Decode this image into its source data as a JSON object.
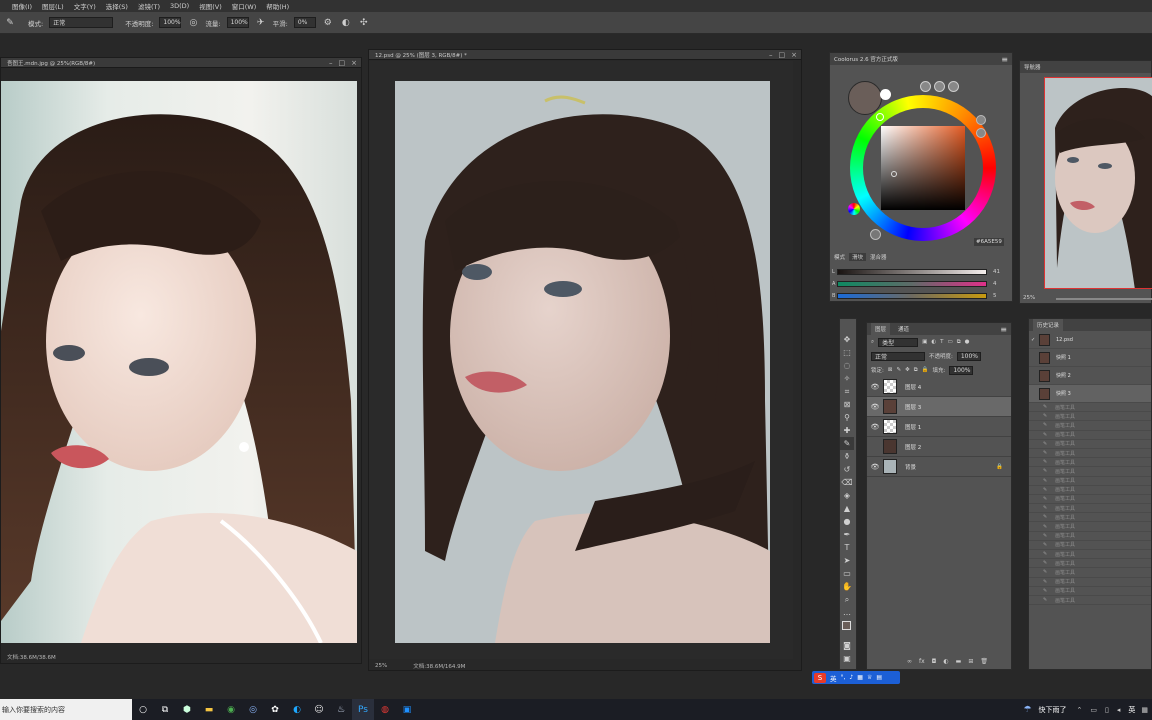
{
  "menu": [
    "图像(I)",
    "图层(L)",
    "文字(Y)",
    "选择(S)",
    "滤镜(T)",
    "3D(D)",
    "视图(V)",
    "窗口(W)",
    "帮助(H)"
  ],
  "options_bar": {
    "mode_label": "模式:",
    "mode_value": "正常",
    "opacity_label": "不透明度:",
    "opacity_value": "100%",
    "flow_label": "流量:",
    "flow_value": "100%",
    "smooth_label": "平滑:",
    "smooth_value": "0%"
  },
  "doc_left": {
    "title": "吾图王.mdn.jpg @ 25%(RGB/8#)",
    "status": "文档:38.6M/38.6M"
  },
  "doc_center": {
    "title": "12.psd @ 25% (图层 3, RGB/8#) *",
    "zoom": "25%",
    "status": "文档:38.6M/164.9M"
  },
  "coolorus": {
    "title": "Coolorus 2.6 官方正式版",
    "hex": "#6A5E59",
    "tab_mode": "模式",
    "tab_slider": "滑块",
    "tab_mixer": "混合器",
    "sliders": [
      {
        "label": "L",
        "value": "41"
      },
      {
        "label": "A",
        "value": "4"
      },
      {
        "label": "B",
        "value": "5"
      }
    ],
    "colors": {
      "current": "#6A5E59",
      "bg": "#535353"
    }
  },
  "navigator": {
    "title": "导航器",
    "zoom": "25%"
  },
  "layers_panel": {
    "tabs": [
      "图层",
      "通道"
    ],
    "filter_label": "类型",
    "blend_mode": "正常",
    "opacity_label": "不透明度:",
    "opacity_value": "100%",
    "lock_label": "锁定:",
    "fill_label": "填充:",
    "fill_value": "100%",
    "layers": [
      {
        "name": "图层 4",
        "visible": true,
        "selected": false
      },
      {
        "name": "图层 3",
        "visible": true,
        "selected": true
      },
      {
        "name": "图层 1",
        "visible": true,
        "selected": false
      },
      {
        "name": "图层 2",
        "visible": false,
        "selected": false
      },
      {
        "name": "背景",
        "visible": true,
        "selected": false
      }
    ]
  },
  "history_panel": {
    "title": "历史记录",
    "snapshot": "12.psd",
    "items": [
      "快照 1",
      "快照 2",
      "快照 3"
    ],
    "tool_step": "画笔工具",
    "tool_step_count": 22
  },
  "ime_bar": {
    "label": "英"
  },
  "taskbar": {
    "search_placeholder": "输入你要搜索的内容",
    "weather": "快下雨了",
    "lang": "英"
  }
}
